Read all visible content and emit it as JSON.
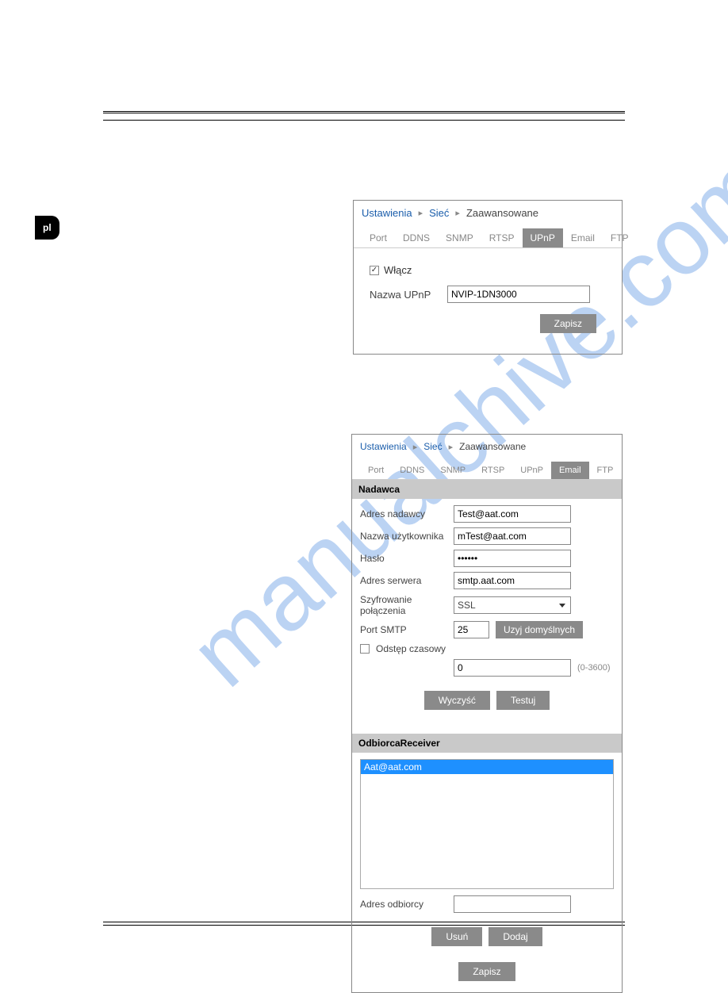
{
  "watermark": "manualchive.com",
  "lang": "pl",
  "panel1": {
    "breadcrumb": [
      "Ustawienia",
      "Sieć",
      "Zaawansowane"
    ],
    "tabs": [
      "Port",
      "DDNS",
      "SNMP",
      "RTSP",
      "UPnP",
      "Email",
      "FTP"
    ],
    "active_tab": "UPnP",
    "enable_checked": true,
    "enable_label": "Włącz",
    "name_label": "Nazwa UPnP",
    "name_value": "NVIP-1DN3000",
    "save_label": "Zapisz"
  },
  "panel2": {
    "breadcrumb": [
      "Ustawienia",
      "Sieć",
      "Zaawansowane"
    ],
    "tabs": [
      "Port",
      "DDNS",
      "SNMP",
      "RTSP",
      "UPnP",
      "Email",
      "FTP"
    ],
    "active_tab": "Email",
    "sender_section": "Nadawca",
    "sender_addr_label": "Adres nadawcy",
    "sender_addr_value": "Test@aat.com",
    "user_label": "Nazwa użytkownika",
    "user_value": "mTest@aat.com",
    "pass_label": "Hasło",
    "pass_value": "••••••",
    "server_label": "Adres serwera",
    "server_value": "smtp.aat.com",
    "encryption_label": "Szyfrowanie połączenia",
    "encryption_value": "SSL",
    "smtp_port_label": "Port SMTP",
    "smtp_port_value": "25",
    "default_btn": "Uzyj domyślnych",
    "interval_label": "Odstęp czasowy",
    "interval_checked": false,
    "interval_value": "0",
    "interval_hint": "(0-3600)",
    "clear_btn": "Wyczyść",
    "test_btn": "Testuj",
    "receiver_section": "OdbiorcaReceiver",
    "receiver_list": [
      "Aat@aat.com"
    ],
    "recipient_label": "Adres odbiorcy",
    "recipient_value": "",
    "delete_btn": "Usuń",
    "add_btn": "Dodaj",
    "save_btn": "Zapisz"
  }
}
